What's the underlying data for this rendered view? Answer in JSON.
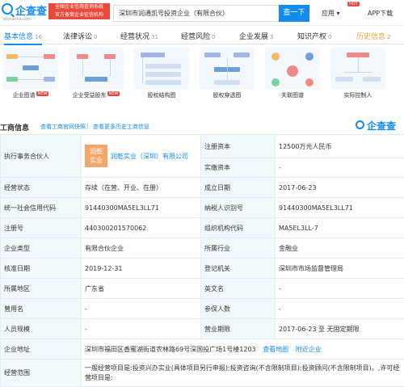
{
  "header": {
    "logo_text": "企查查",
    "logo_url": "qichacha.com",
    "slogan_line1": "全国企业信用查询系统",
    "slogan_line2": "官方备案企业征信机构",
    "search_value": "深圳市润通凯号投资企业（有限合伙）",
    "search_button": "查一下",
    "app_menu": "应用",
    "hot_badge": "HOT",
    "app_download": "APP下载"
  },
  "tabs": [
    {
      "label": "基本信息",
      "count": "16"
    },
    {
      "label": "法律诉讼",
      "count": "0"
    },
    {
      "label": "经营状况",
      "count": "31"
    },
    {
      "label": "经营风险",
      "count": "0"
    },
    {
      "label": "企业发展",
      "count": "3"
    },
    {
      "label": "知识产权",
      "count": "0"
    },
    {
      "label": "历史信息",
      "count": "2"
    }
  ],
  "graphs": [
    {
      "label": "企业图谱",
      "badge": "NEW"
    },
    {
      "label": "企业受益股东",
      "badge": "NEW"
    },
    {
      "label": "股权结构图",
      "badge": ""
    },
    {
      "label": "股权穿透图",
      "badge": ""
    },
    {
      "label": "关联图谱",
      "badge": ""
    },
    {
      "label": "实际控制人",
      "badge": ""
    }
  ],
  "section": {
    "title": "工商信息",
    "link1": "查看工商官网快照",
    "separator": "|",
    "link2": "查看更多历史工商信息",
    "brand": "企查查"
  },
  "company_logo": {
    "line1": "润乾",
    "line2": "实业"
  },
  "table": {
    "r1": {
      "k1": "执行事务合伙人",
      "v1": "润乾实业（深圳）有限公司",
      "k2": "注册资本",
      "v2": "12500万元人民币"
    },
    "r2": {
      "k2": "实缴资本",
      "v2": "-"
    },
    "r3": {
      "k1": "经营状态",
      "v1": "存续（在营、开业、在册）",
      "k2": "成立日期",
      "v2": "2017-06-23"
    },
    "r4": {
      "k1": "统一社会信用代码",
      "v1": "91440300MA5EL3LL71",
      "k2": "纳税人识别号",
      "v2": "91440300MA5EL3LL71"
    },
    "r5": {
      "k1": "注册号",
      "v1": "440300201570062",
      "k2": "组织机构代码",
      "v2": "MA5EL3LL-7"
    },
    "r6": {
      "k1": "企业类型",
      "v1": "有限合伙企业",
      "k2": "所属行业",
      "v2": "金融业"
    },
    "r7": {
      "k1": "核准日期",
      "v1": "2019-12-31",
      "k2": "登记机关",
      "v2": "深圳市市场监督管理局"
    },
    "r8": {
      "k1": "所属地区",
      "v1": "广东省",
      "k2": "英文名",
      "v2": "-"
    },
    "r9": {
      "k1": "曾用名",
      "v1": "-",
      "k2": "参保人数",
      "v2": "-"
    },
    "r10": {
      "k1": "人员规模",
      "v1": "-",
      "k2": "营业期限",
      "v2": "2017-06-23 至 无固定期限"
    },
    "r11": {
      "k1": "企业地址",
      "v1": "深圳市福田区香蜜湖街道农林路69号深国投广场1号楼1203",
      "link1": "查看地图",
      "link2": "附近企业"
    },
    "r12": {
      "k1": "经营范围",
      "v1": "一般经营项目是:投资兴办实业(具体项目另行申报);投资咨询(不含限制项目);投资顾问(不含限制项目)。,许可经营项目是:"
    }
  }
}
